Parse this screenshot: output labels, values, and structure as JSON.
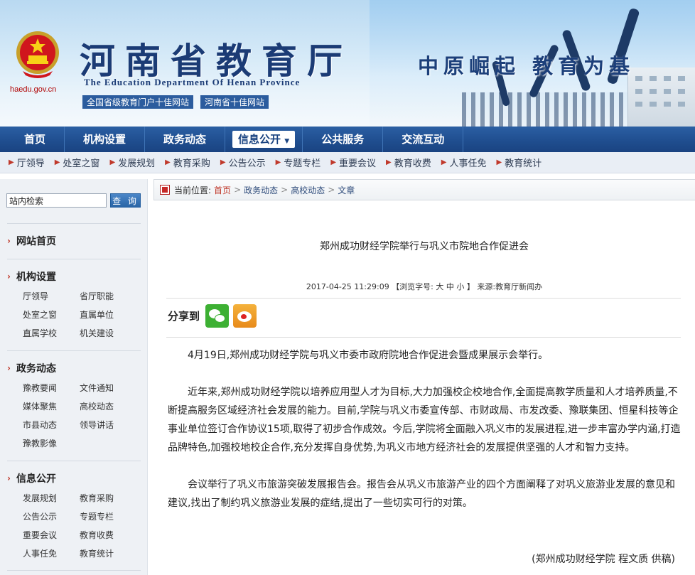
{
  "header": {
    "domain": "haedu.gov.cn",
    "title": "河南省教育厅",
    "title_en": "The Education Department Of Henan Province",
    "awards": [
      "全国省级教育门户十佳网站",
      "河南省十佳网站"
    ],
    "slogan": "中原崛起  教育为基"
  },
  "main_nav": [
    "首页",
    "机构设置",
    "政务动态",
    "信息公开",
    "公共服务",
    "交流互动"
  ],
  "main_nav_active": "信息公开",
  "sub_nav": [
    "厅领导",
    "处室之窗",
    "发展规划",
    "教育采购",
    "公告公示",
    "专题专栏",
    "重要会议",
    "教育收费",
    "人事任免",
    "教育统计"
  ],
  "sidebar": {
    "search_value": "站内检索",
    "search_button": "查 询",
    "sections": [
      {
        "title": "网站首页",
        "links": []
      },
      {
        "title": "机构设置",
        "links": [
          "厅领导",
          "省厅职能",
          "处室之窗",
          "直属单位",
          "直属学校",
          "机关建设"
        ]
      },
      {
        "title": "政务动态",
        "links": [
          "豫教要闻",
          "文件通知",
          "媒体聚焦",
          "高校动态",
          "市县动态",
          "领导讲话",
          "豫教影像"
        ]
      },
      {
        "title": "信息公开",
        "links": [
          "发展规划",
          "教育采购",
          "公告公示",
          "专题专栏",
          "重要会议",
          "教育收费",
          "人事任免",
          "教育统计"
        ]
      }
    ]
  },
  "breadcrumb": {
    "label": "当前位置:",
    "items": [
      "首页",
      "政务动态",
      "高校动态",
      "文章"
    ]
  },
  "article": {
    "title": "郑州成功财经学院举行与巩义市院地合作促进会",
    "datetime": "2017-04-25 11:29:09",
    "font_label": "【浏览字号:",
    "font_sizes": [
      "大",
      "中",
      "小"
    ],
    "font_close": "】",
    "source": "来源:教育厅新闻办",
    "share_label": "分享到",
    "paragraphs": [
      "4月19日,郑州成功财经学院与巩义市委市政府院地合作促进会暨成果展示会举行。",
      "近年来,郑州成功财经学院以培养应用型人才为目标,大力加强校企校地合作,全面提高教学质量和人才培养质量,不断提高服务区域经济社会发展的能力。目前,学院与巩义市委宣传部、市财政局、市发改委、豫联集团、恒星科技等企事业单位签订合作协议15项,取得了初步合作成效。今后,学院将全面融入巩义市的发展进程,进一步丰富办学内涵,打造品牌特色,加强校地校企合作,充分发挥自身优势,为巩义市地方经济社会的发展提供坚强的人才和智力支持。",
      "会议举行了巩义市旅游突破发展报告会。报告会从巩义市旅游产业的四个方面阐释了对巩义旅游业发展的意见和建议,找出了制约巩义旅游业发展的症结,提出了一些切实可行的对策。"
    ],
    "author": "(郑州成功财经学院 程文质 供稿)"
  },
  "colors": {
    "nav": "#1f4d8e",
    "accent": "#c0392b",
    "title": "#1b3b75"
  }
}
